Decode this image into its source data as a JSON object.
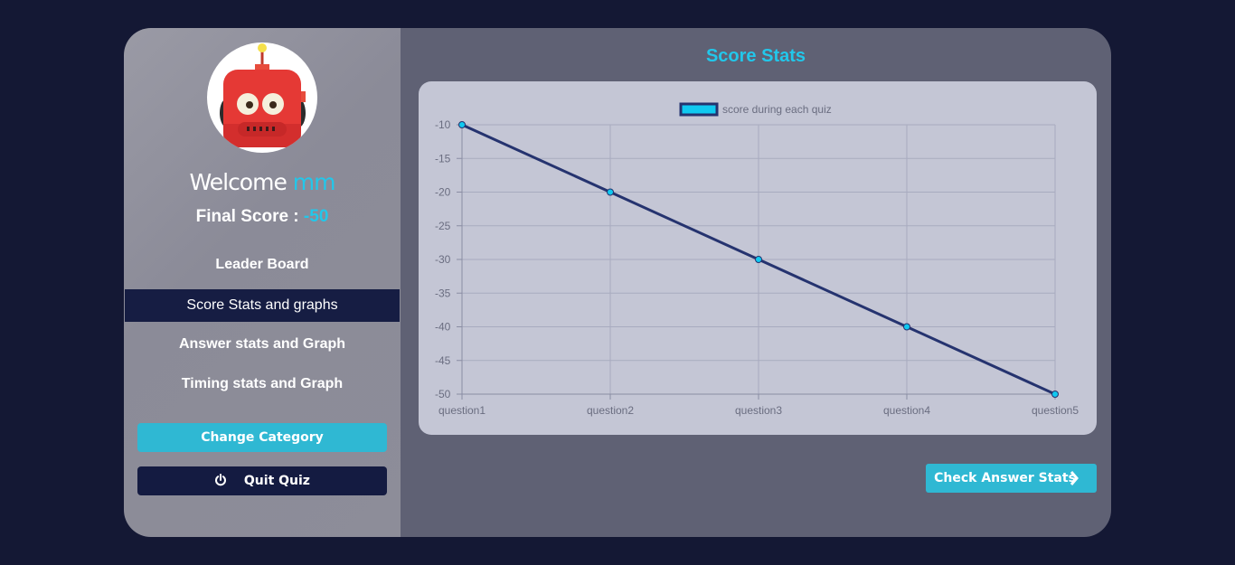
{
  "sidebar": {
    "welcome_text": "Welcome",
    "username": "mm",
    "final_score_label": "Final Score :",
    "final_score_value": "-50",
    "nav": [
      {
        "label": "Leader Board",
        "active": false
      },
      {
        "label": "Score Stats and graphs",
        "active": true
      },
      {
        "label": "Answer stats and Graph",
        "active": false
      },
      {
        "label": "Timing stats and Graph",
        "active": false
      }
    ],
    "change_category_label": "Change Category",
    "quit_label": "Quit Quiz",
    "quit_icon": "power-icon",
    "avatar_icon": "robot-avatar"
  },
  "main": {
    "title": "Score Stats",
    "next_button_label": "Check Answer Stats",
    "next_icon": "chevron-right-icon"
  },
  "colors": {
    "accent": "#22c7ea",
    "nav_active_bg": "#161d43",
    "button_cyan": "#2fb8d3",
    "line_color": "#25336f",
    "point_fill": "#10c9f0"
  },
  "chart_data": {
    "type": "line",
    "categories": [
      "question1",
      "question2",
      "question3",
      "question4",
      "question5"
    ],
    "series": [
      {
        "name": "score during each quiz",
        "values": [
          -10,
          -20,
          -30,
          -40,
          -50
        ]
      }
    ],
    "yticks": [
      -10,
      -15,
      -20,
      -25,
      -30,
      -35,
      -40,
      -45,
      -50
    ],
    "ylim": [
      -50,
      -10
    ],
    "grid": true,
    "legend": "top-center"
  }
}
